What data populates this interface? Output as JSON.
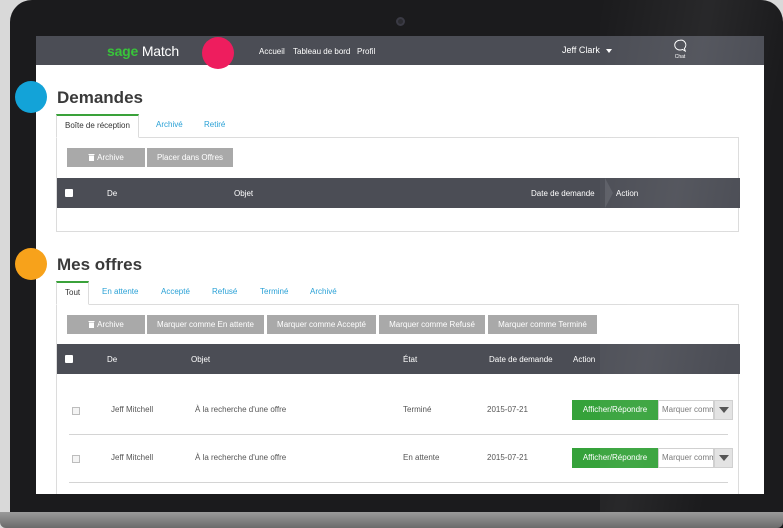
{
  "brand": {
    "prefix": "sage",
    "suffix": " Match"
  },
  "nav": {
    "home": "Accueil",
    "dashboard": "Tableau de bord",
    "profile": "Profil"
  },
  "user": {
    "name": "Jeff Clark"
  },
  "chat": {
    "label": "Chat"
  },
  "requests": {
    "title": "Demandes",
    "tabs": [
      "Boîte de réception",
      "Archivé",
      "Retiré"
    ],
    "buttons": {
      "archive": "Archive",
      "move_to_offers": "Placer dans Offres"
    },
    "columns": {
      "from": "De",
      "subject": "Objet",
      "date": "Date de demande",
      "action": "Action"
    }
  },
  "offers": {
    "title": "Mes offres",
    "tabs": [
      "Tout",
      "En attente",
      "Accepté",
      "Refusé",
      "Terminé",
      "Archivé"
    ],
    "buttons": {
      "archive": "Archive",
      "mark_pending": "Marquer comme En attente",
      "mark_accepted": "Marquer comme Accepté",
      "mark_refused": "Marquer comme Refusé",
      "mark_done": "Marquer comme Terminé"
    },
    "columns": {
      "from": "De",
      "subject": "Objet",
      "status": "État",
      "date": "Date de demande",
      "action": "Action"
    },
    "rows": [
      {
        "from": "Jeff Mitchell",
        "subject": "À la recherche d'une offre",
        "status": "Terminé",
        "date": "2015-07-21",
        "action": "Afficher/Répondre",
        "select": "Marquer comm"
      },
      {
        "from": "Jeff Mitchell",
        "subject": "À la recherche d'une offre",
        "status": "En attente",
        "date": "2015-07-21",
        "action": "Afficher/Répondre",
        "select": "Marquer comm"
      }
    ]
  },
  "colors": {
    "accent_green": "#35a23a",
    "brand_green": "#38c43a",
    "link_blue": "#2aa1d6",
    "header_dark": "#4b4d55",
    "marker_pink": "#ee1d5e",
    "marker_blue": "#13a3d8",
    "marker_orange": "#f7a21b"
  }
}
